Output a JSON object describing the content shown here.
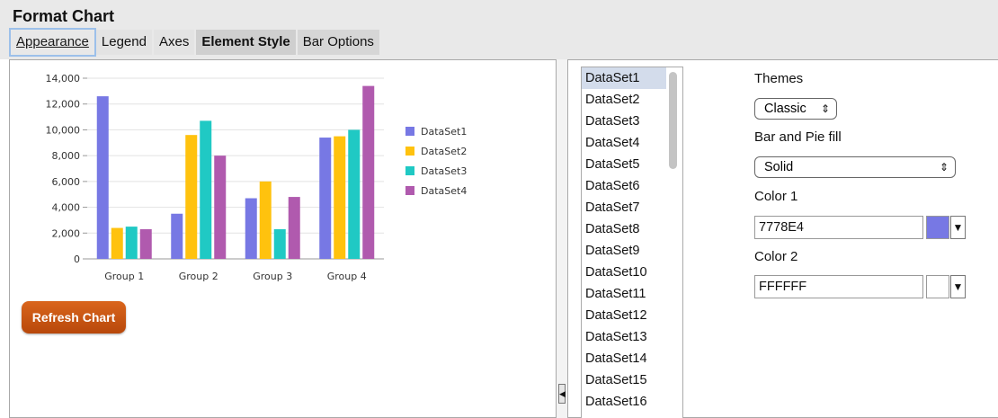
{
  "dialog": {
    "title": "Format Chart"
  },
  "tabs": [
    {
      "label": "Appearance",
      "active": true
    },
    {
      "label": "Legend"
    },
    {
      "label": "Axes"
    },
    {
      "label": "Element Style"
    },
    {
      "label": "Bar Options"
    }
  ],
  "refresh_button": {
    "label": "Refresh Chart"
  },
  "datasets": {
    "items": [
      "DataSet1",
      "DataSet2",
      "DataSet3",
      "DataSet4",
      "DataSet5",
      "DataSet6",
      "DataSet7",
      "DataSet8",
      "DataSet9",
      "DataSet10",
      "DataSet11",
      "DataSet12",
      "DataSet13",
      "DataSet14",
      "DataSet15",
      "DataSet16"
    ],
    "selected_index": 0
  },
  "style": {
    "themes_label": "Themes",
    "themes_value": "Classic",
    "fill_label": "Bar and Pie fill",
    "fill_value": "Solid",
    "color1_label": "Color 1",
    "color1_value": "7778E4",
    "color1_swatch": "#7778E4",
    "color2_label": "Color 2",
    "color2_value": "FFFFFF",
    "color2_swatch": "#FFFFFF",
    "updown_glyph": "⇕",
    "dropdown_glyph": "▼",
    "collapse_glyph": "◀"
  },
  "chart_data": {
    "type": "bar",
    "categories": [
      "Group 1",
      "Group 2",
      "Group 3",
      "Group 4"
    ],
    "series": [
      {
        "name": "DataSet1",
        "color": "#7778E4",
        "values": [
          12600,
          3500,
          4700,
          9400
        ]
      },
      {
        "name": "DataSet2",
        "color": "#FFC20E",
        "values": [
          2400,
          9600,
          6000,
          9500
        ]
      },
      {
        "name": "DataSet3",
        "color": "#20C9C4",
        "values": [
          2500,
          10700,
          2300,
          10000
        ]
      },
      {
        "name": "DataSet4",
        "color": "#B05AAE",
        "values": [
          2300,
          8000,
          4800,
          13400
        ]
      }
    ],
    "yticks": [
      "0",
      "2,000",
      "4,000",
      "6,000",
      "8,000",
      "10,000",
      "12,000",
      "14,000"
    ],
    "ylim": [
      0,
      14000
    ],
    "legend": "right"
  }
}
